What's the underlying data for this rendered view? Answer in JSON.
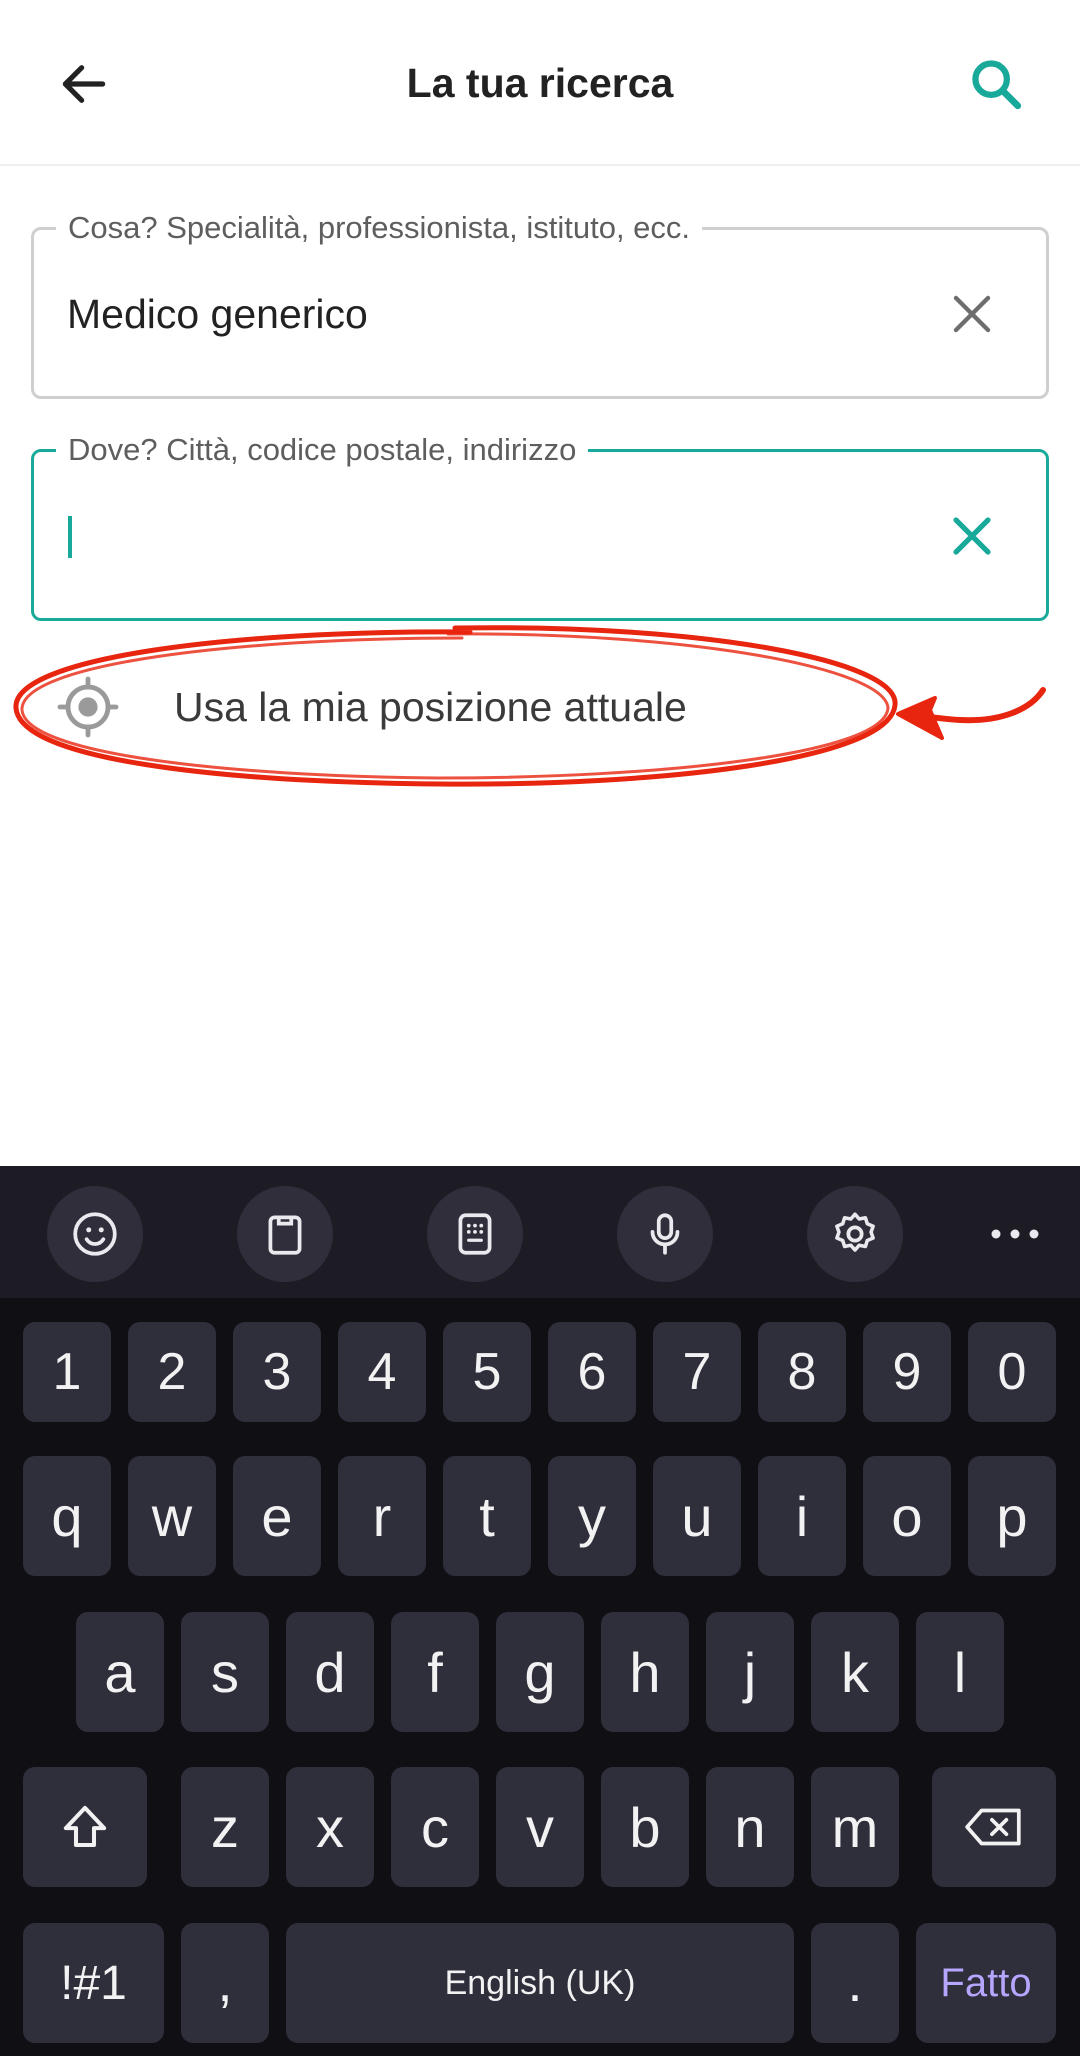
{
  "header": {
    "title": "La tua ricerca",
    "back_icon": "arrow-left-icon",
    "search_icon": "search-icon",
    "accent_color": "#19a99a"
  },
  "fields": {
    "what": {
      "label": "Cosa? Specialità, professionista, istituto, ecc.",
      "value": "Medico generico",
      "clear_icon": "close-icon"
    },
    "where": {
      "label": "Dove? Città, codice postale, indirizzo",
      "value": "",
      "clear_icon": "close-icon"
    }
  },
  "location_option": {
    "label": "Usa la mia posizione attuale",
    "icon": "gps-target-icon"
  },
  "annotation": {
    "color": "#e8250f",
    "shape": "hand-drawn ellipse with arrow"
  },
  "keyboard": {
    "toolbar": [
      "emoji-icon",
      "clipboard-icon",
      "keyboard-layout-icon",
      "microphone-icon",
      "settings-icon",
      "more-icon"
    ],
    "number_row": [
      "1",
      "2",
      "3",
      "4",
      "5",
      "6",
      "7",
      "8",
      "9",
      "0"
    ],
    "row1": [
      "q",
      "w",
      "e",
      "r",
      "t",
      "y",
      "u",
      "i",
      "o",
      "p"
    ],
    "row2": [
      "a",
      "s",
      "d",
      "f",
      "g",
      "h",
      "j",
      "k",
      "l"
    ],
    "row3": [
      "z",
      "x",
      "c",
      "v",
      "b",
      "n",
      "m"
    ],
    "symbols_label": "!#1",
    "comma_label": ",",
    "space_label": "English (UK)",
    "period_label": ".",
    "done_label": "Fatto",
    "done_color": "#b7a6ff"
  }
}
